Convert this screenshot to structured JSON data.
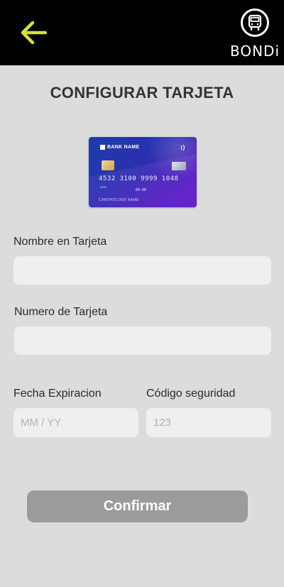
{
  "header": {
    "back_icon": "arrow-left-icon",
    "logo_icon": "bus-icon",
    "logo_text": "BONDi",
    "accent_color": "#d4e235"
  },
  "title": "CONFIGURAR TARJETA",
  "card": {
    "bank_name": "BANK NAME",
    "number": "4532 3100 9999 1048",
    "small_code": "2000",
    "expiry": "00-00",
    "holder": "CARDHOLDER NAME"
  },
  "form": {
    "name_label": "Nombre en Tarjeta",
    "name_value": "",
    "number_label": "Numero de Tarjeta",
    "number_value": "",
    "expiry_label": "Fecha Expiracion",
    "expiry_placeholder": "MM / YY",
    "cvv_label": "Código seguridad",
    "cvv_placeholder": "123"
  },
  "confirm_label": "Confirmar"
}
